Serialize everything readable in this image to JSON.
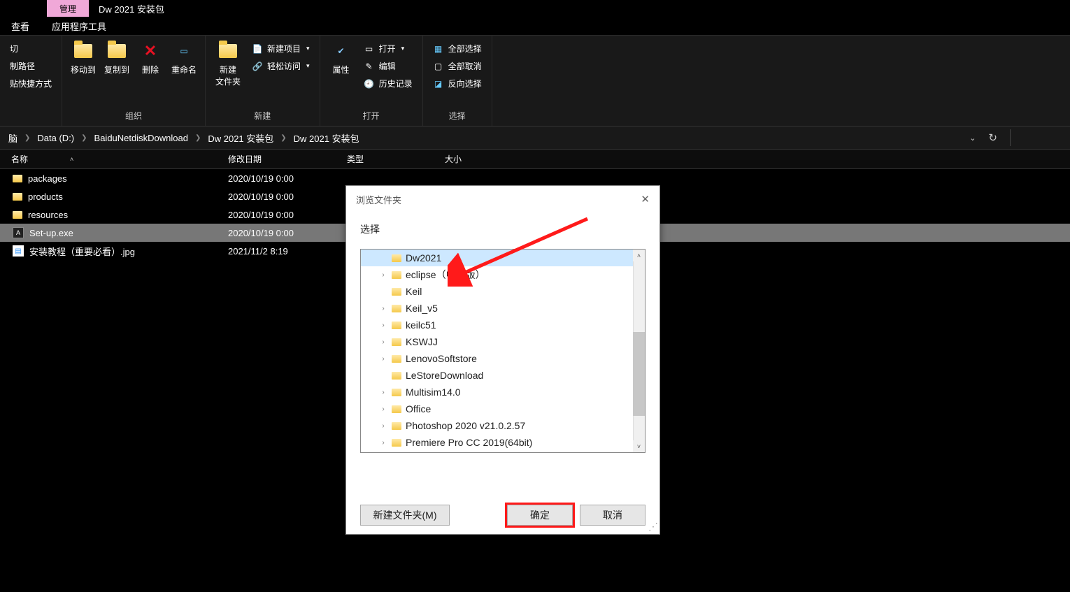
{
  "titlebar": {
    "manage_tab": "管理",
    "window_title": "Dw 2021 安装包"
  },
  "menu": {
    "view": "查看",
    "app_tools": "应用程序工具"
  },
  "ribbon_left": {
    "cut": "切",
    "copy_path": "制路径",
    "paste_shortcut": "贴快捷方式"
  },
  "ribbon": {
    "organize": {
      "move_to": "移动到",
      "copy_to": "复制到",
      "delete": "删除",
      "rename": "重命名",
      "label": "组织"
    },
    "new": {
      "new_folder": "新建\n文件夹",
      "new_item": "新建项目",
      "easy_access": "轻松访问",
      "label": "新建"
    },
    "open": {
      "properties": "属性",
      "open": "打开",
      "edit": "编辑",
      "history": "历史记录",
      "label": "打开"
    },
    "select": {
      "select_all": "全部选择",
      "select_none": "全部取消",
      "invert": "反向选择",
      "label": "选择"
    }
  },
  "breadcrumb": {
    "items": [
      "脑",
      "Data (D:)",
      "BaiduNetdiskDownload",
      "Dw 2021 安装包",
      "Dw 2021 安装包"
    ]
  },
  "columns": {
    "name": "名称",
    "date": "修改日期",
    "type": "类型",
    "size": "大小"
  },
  "files": [
    {
      "icon": "folder",
      "name": "packages",
      "date": "2020/10/19 0:00"
    },
    {
      "icon": "folder",
      "name": "products",
      "date": "2020/10/19 0:00"
    },
    {
      "icon": "folder",
      "name": "resources",
      "date": "2020/10/19 0:00"
    },
    {
      "icon": "exe",
      "name": "Set-up.exe",
      "date": "2020/10/19 0:00",
      "selected": true
    },
    {
      "icon": "img",
      "name": "安装教程（重要必看）.jpg",
      "date": "2021/11/2 8:19"
    }
  ],
  "dialog": {
    "title": "浏览文件夹",
    "select_label": "选择",
    "tree": [
      {
        "name": "Dw2021",
        "selected": true,
        "expandable": false
      },
      {
        "name": "eclipse（中文版）",
        "expandable": true
      },
      {
        "name": "Keil",
        "expandable": false
      },
      {
        "name": "Keil_v5",
        "expandable": true
      },
      {
        "name": "keilc51",
        "expandable": true
      },
      {
        "name": "KSWJJ",
        "expandable": true
      },
      {
        "name": "LenovoSoftstore",
        "expandable": true
      },
      {
        "name": "LeStoreDownload",
        "expandable": false
      },
      {
        "name": "Multisim14.0",
        "expandable": true
      },
      {
        "name": "Office",
        "expandable": true
      },
      {
        "name": "Photoshop 2020 v21.0.2.57",
        "expandable": true
      },
      {
        "name": "Premiere Pro CC 2019(64bit)",
        "expandable": true
      }
    ],
    "new_folder_btn": "新建文件夹(M)",
    "ok_btn": "确定",
    "cancel_btn": "取消"
  }
}
